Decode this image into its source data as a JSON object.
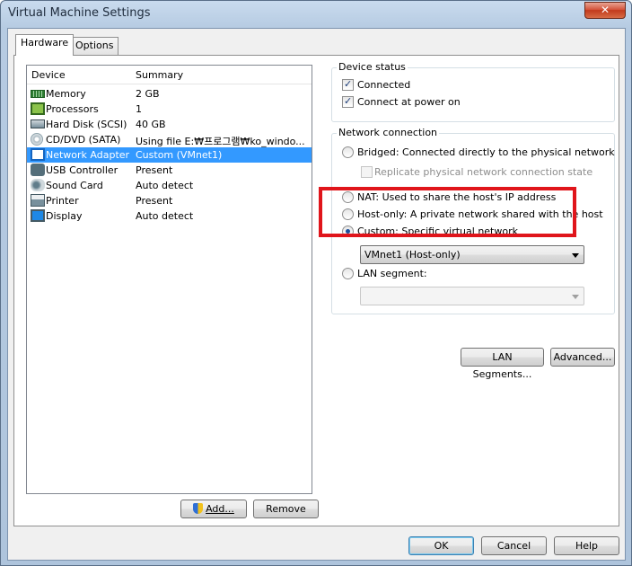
{
  "window": {
    "title": "Virtual Machine Settings",
    "close_label": "✕"
  },
  "tabs": [
    {
      "label": "Hardware"
    },
    {
      "label": "Options"
    }
  ],
  "device_list": {
    "columns": {
      "device": "Device",
      "summary": "Summary"
    },
    "rows": [
      {
        "device": "Memory",
        "summary": "2 GB",
        "icon": "memory-icon"
      },
      {
        "device": "Processors",
        "summary": "1",
        "icon": "processor-icon"
      },
      {
        "device": "Hard Disk (SCSI)",
        "summary": "40 GB",
        "icon": "hard-disk-icon"
      },
      {
        "device": "CD/DVD (SATA)",
        "summary": "Using file E:₩프로그램₩ko_windo...",
        "icon": "cd-dvd-icon"
      },
      {
        "device": "Network Adapter",
        "summary": "Custom (VMnet1)",
        "icon": "network-adapter-icon",
        "selected": true
      },
      {
        "device": "USB Controller",
        "summary": "Present",
        "icon": "usb-icon"
      },
      {
        "device": "Sound Card",
        "summary": "Auto detect",
        "icon": "sound-card-icon"
      },
      {
        "device": "Printer",
        "summary": "Present",
        "icon": "printer-icon"
      },
      {
        "device": "Display",
        "summary": "Auto detect",
        "icon": "display-icon"
      }
    ]
  },
  "list_buttons": {
    "add": "Add...",
    "remove": "Remove"
  },
  "device_status": {
    "legend": "Device status",
    "connected": "Connected",
    "connect_at_power_on": "Connect at power on"
  },
  "network_connection": {
    "legend": "Network connection",
    "bridged": "Bridged: Connected directly to the physical network",
    "replicate": "Replicate physical network connection state",
    "nat": "NAT: Used to share the host's IP address",
    "host_only": "Host-only: A private network shared with the host",
    "custom": "Custom: Specific virtual network",
    "custom_value": "VMnet1 (Host-only)",
    "lan_segment": "LAN segment:",
    "lan_segment_value": ""
  },
  "side_buttons": {
    "lan_segments": "LAN Segments...",
    "advanced": "Advanced..."
  },
  "footer": {
    "ok": "OK",
    "cancel": "Cancel",
    "help": "Help"
  },
  "colors": {
    "selection": "#3399ff",
    "highlight": "#e0151b"
  }
}
